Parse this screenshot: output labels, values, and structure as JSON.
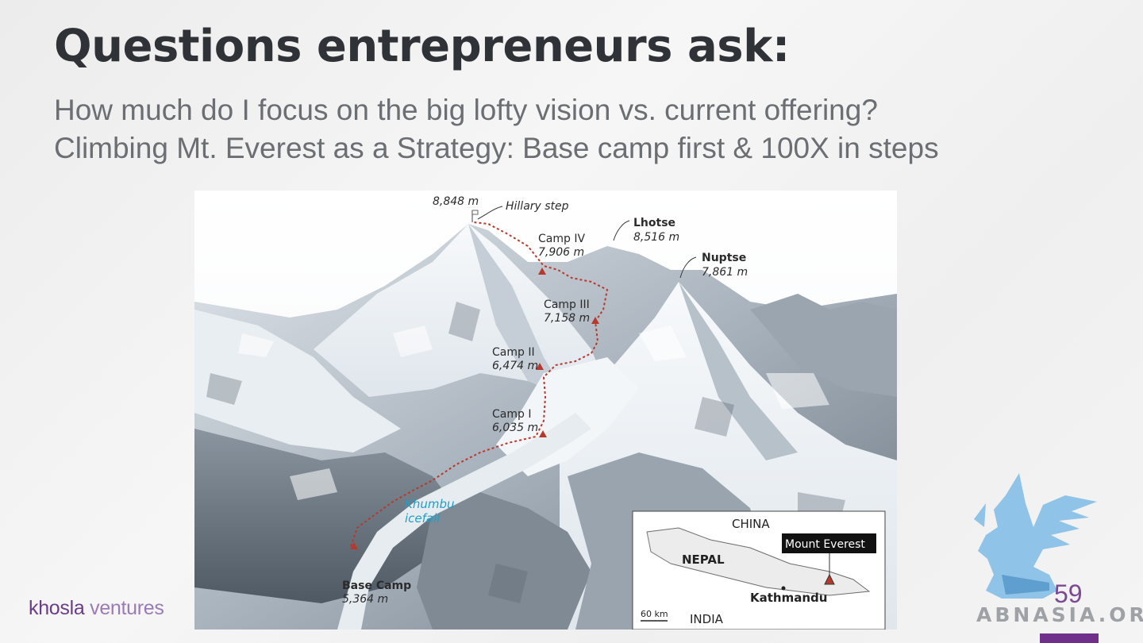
{
  "slide": {
    "title": "Questions entrepreneurs ask:",
    "subtitle_line1": "How much do I focus on the big lofty vision vs. current offering?",
    "subtitle_line2": "Climbing Mt. Everest as a Strategy: Base camp first & 100X in steps",
    "page_number": "59"
  },
  "branding": {
    "company_bold": "khosla",
    "company_light": " ventures",
    "watermark": "ABNASIA.ORG"
  },
  "map": {
    "summit_elevation": "8,848 m",
    "hillary_step": "Hillary step",
    "lhotse_name": "Lhotse",
    "lhotse_elevation": "8,516 m",
    "camp4_name": "Camp IV",
    "camp4_elevation": "7,906 m",
    "nuptse_name": "Nuptse",
    "nuptse_elevation": "7,861 m",
    "camp3_name": "Camp III",
    "camp3_elevation": "7,158 m",
    "camp2_name": "Camp II",
    "camp2_elevation": "6,474 m",
    "camp1_name": "Camp I",
    "camp1_elevation": "6,035 m",
    "icefall_line1": "Khumbu",
    "icefall_line2": "icefall",
    "basecamp_name": "Base Camp",
    "basecamp_elevation": "5,364 m"
  },
  "inset": {
    "china": "CHINA",
    "nepal": "NEPAL",
    "mount_everest": "Mount Everest",
    "kathmandu": "Kathmandu",
    "scale": "60 km",
    "india": "INDIA"
  },
  "colors": {
    "title": "#2f3237",
    "subtitle": "#6b6e72",
    "brand_purple": "#6f2f8a",
    "route_red": "#b5392c",
    "icefall_blue": "#1f9fc8"
  }
}
